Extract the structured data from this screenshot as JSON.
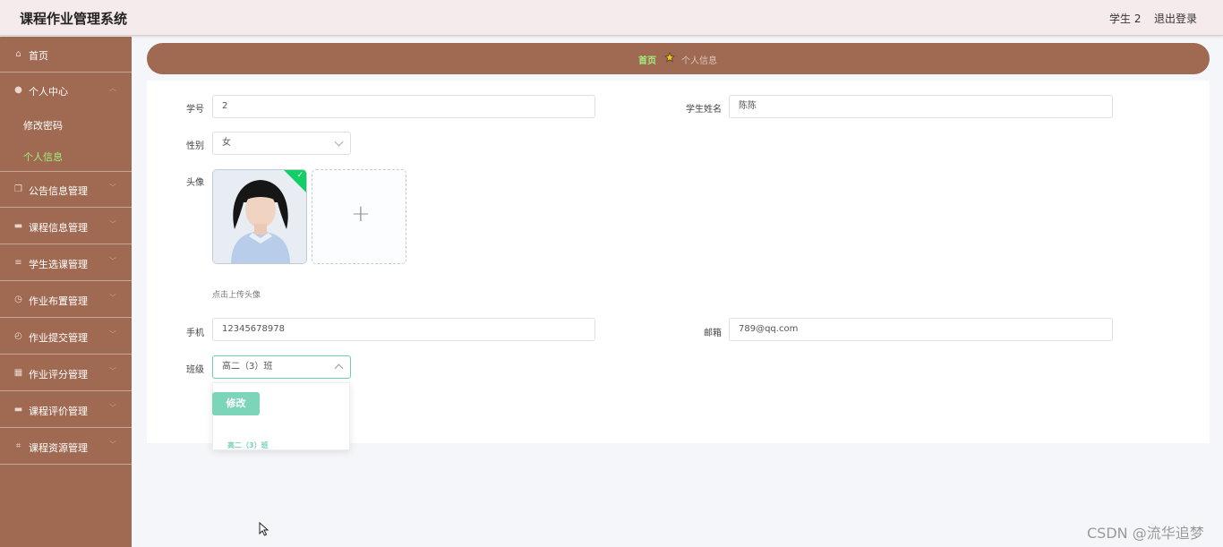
{
  "header": {
    "title": "课程作业管理系统",
    "user": "学生 2",
    "logout": "退出登录"
  },
  "sidebar": {
    "home": "首页",
    "personal_center": "个人中心",
    "sub": [
      "修改密码",
      "个人信息"
    ],
    "items": [
      "公告信息管理",
      "课程信息管理",
      "学生选课管理",
      "作业布置管理",
      "作业提交管理",
      "作业评分管理",
      "课程评价管理",
      "课程资源管理"
    ]
  },
  "breadcrumb": {
    "home": "首页",
    "current": "个人信息"
  },
  "form": {
    "student_no_label": "学号",
    "student_no": "2",
    "student_name_label": "学生姓名",
    "student_name": "陈陈",
    "gender_label": "性别",
    "gender": "女",
    "avatar_label": "头像",
    "upload_hint": "点击上传头像",
    "phone_label": "手机",
    "phone": "12345678978",
    "email_label": "邮箱",
    "email": "789@qq.com",
    "class_label": "班级",
    "class": "高二（3）班",
    "class_options": [
      "高二（3）班"
    ],
    "submit": "修改"
  },
  "watermark": "CSDN @流华追梦",
  "colors": {
    "sidebar": "#a06a52",
    "accent_green": "#9ff07a",
    "button": "#6ad0b0",
    "success_badge": "#13ce66"
  }
}
